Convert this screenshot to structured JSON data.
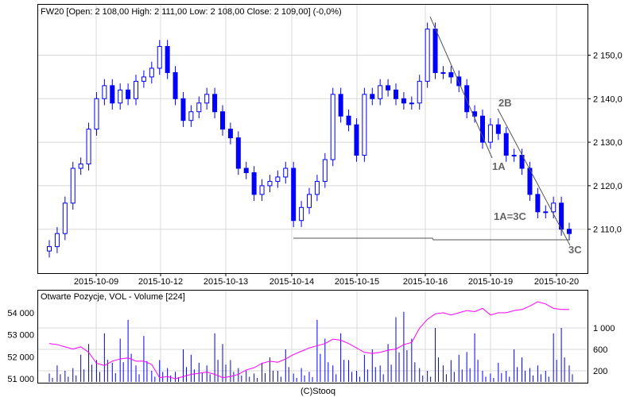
{
  "chart_data": [
    {
      "type": "candlestick",
      "title": "FW20 [Open: 2 108,00  High: 2 111,00  Low: 2 108,00  Close: 2 109,00] (-0,0%)",
      "y_ticks": [
        "2 150,0",
        "2 140,0",
        "2 130,0",
        "2 120,0",
        "2 110,0"
      ],
      "y_tick_values": [
        2150,
        2140,
        2130,
        2120,
        2110
      ],
      "x_ticks": [
        "2015-10-09",
        "2015-10-12",
        "2015-10-13",
        "2015-10-14",
        "2015-10-15",
        "2015-10-16",
        "2015-10-19",
        "2015-10-20"
      ],
      "ylim": [
        2101,
        2163
      ],
      "grid": true,
      "close": [
        2106,
        2109,
        2116,
        2124,
        2125,
        2133,
        2140,
        2143,
        2139,
        2142,
        2140,
        2144,
        2145,
        2147,
        2152,
        2146,
        2140,
        2135,
        2137,
        2139,
        2141,
        2137,
        2133,
        2131,
        2124,
        2123,
        2118,
        2120,
        2121,
        2122,
        2124,
        2112,
        2115,
        2118,
        2121,
        2126,
        2141,
        2136,
        2134,
        2127,
        2141,
        2140,
        2143,
        2142,
        2140,
        2139,
        2139,
        2144,
        2156,
        2146,
        2146,
        2145,
        2143,
        2137,
        2136,
        2130,
        2134,
        2132,
        2127,
        2127,
        2124,
        2118,
        2114,
        2114,
        2116,
        2110,
        2109
      ],
      "annotations": [
        "2B",
        "1A",
        "1A=3C",
        "3C"
      ],
      "color": "#0000ff"
    },
    {
      "type": "bar+line",
      "title": "Otwarte Pozycje, VOL - Volume [224]",
      "left_ticks": [
        "54 000",
        "53 000",
        "52 000",
        "51 000"
      ],
      "left_tick_values": [
        54000,
        53000,
        52000,
        51000
      ],
      "right_ticks": [
        "1 000",
        "600",
        "200"
      ],
      "right_tick_values": [
        1000,
        600,
        200
      ],
      "volume": [
        150,
        300,
        200,
        250,
        500,
        700,
        400,
        900,
        350,
        800,
        1150,
        300,
        850,
        200,
        400,
        250,
        180,
        600,
        500,
        350,
        300,
        900,
        700,
        400,
        250,
        200,
        150,
        350,
        450,
        200,
        600,
        150,
        250,
        180,
        1150,
        800,
        300,
        900,
        400,
        200,
        500,
        600,
        300,
        700,
        1200,
        1300,
        800,
        250,
        200,
        1000,
        300,
        400,
        500,
        550,
        900,
        200,
        150,
        350,
        200,
        600,
        450,
        250,
        300,
        200,
        900,
        1000,
        300
      ],
      "open_interest": [
        52600,
        52550,
        52450,
        52350,
        52450,
        52200,
        51700,
        51600,
        51800,
        51900,
        51950,
        51800,
        51800,
        51650,
        51050,
        51100,
        51000,
        51100,
        51200,
        51250,
        51300,
        51200,
        51050,
        51100,
        51200,
        51400,
        51500,
        51700,
        51800,
        51750,
        51900,
        52100,
        52250,
        52400,
        52500,
        52600,
        52800,
        52750,
        52600,
        52400,
        52200,
        52150,
        52200,
        52300,
        52350,
        52550,
        52650,
        53300,
        53700,
        53950,
        54000,
        53900,
        54000,
        54100,
        54050,
        54200,
        53900,
        54000,
        54000,
        54100,
        54150,
        54300,
        54500,
        54400,
        54200,
        54150,
        54150
      ],
      "volume_color": "#0000ff",
      "oi_color": "#ff00ff"
    }
  ],
  "footer": "(C)Stooq"
}
